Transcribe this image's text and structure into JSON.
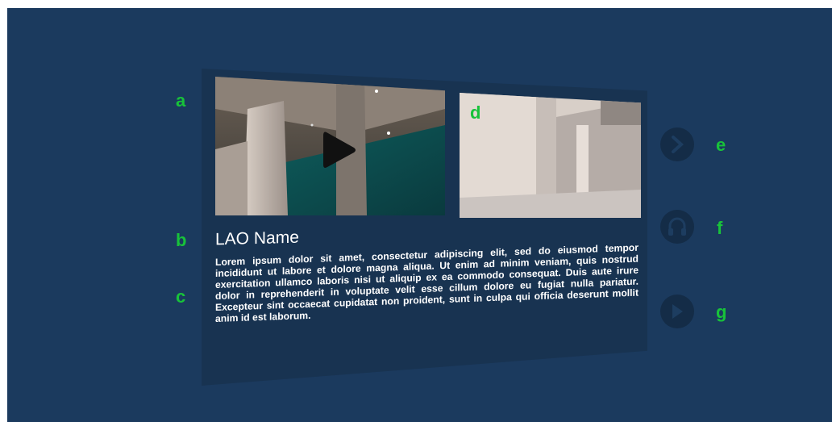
{
  "labels": {
    "a": "a",
    "b": "b",
    "c": "c",
    "d": "d",
    "e": "e",
    "f": "f",
    "g": "g"
  },
  "lao": {
    "name": "LAO Name",
    "description": "Lorem ipsum dolor sit amet, consectetur adipiscing elit, sed do eiusmod tempor incididunt ut labore et dolore magna aliqua. Ut enim ad minim veniam, quis nostrud exercitation ullamco laboris nisi ut aliquip ex ea commodo consequat. Duis aute irure dolor in reprehenderit in voluptate velit esse cillum dolore eu fugiat nulla pariatur. Excepteur sint occaecat cupidatat non proident, sunt in culpa qui officia deserunt mollit anim id est laborum."
  },
  "media": {
    "video_icon": "play-icon",
    "image_subject": "interior-room-image"
  },
  "buttons": {
    "next_icon": "chevron-right-icon",
    "audio_icon": "headphones-icon",
    "play_icon": "play-icon"
  },
  "colors": {
    "background": "#1b3a5e",
    "panel": "#183351",
    "label_green": "#18c23a",
    "button": "#142c47"
  }
}
